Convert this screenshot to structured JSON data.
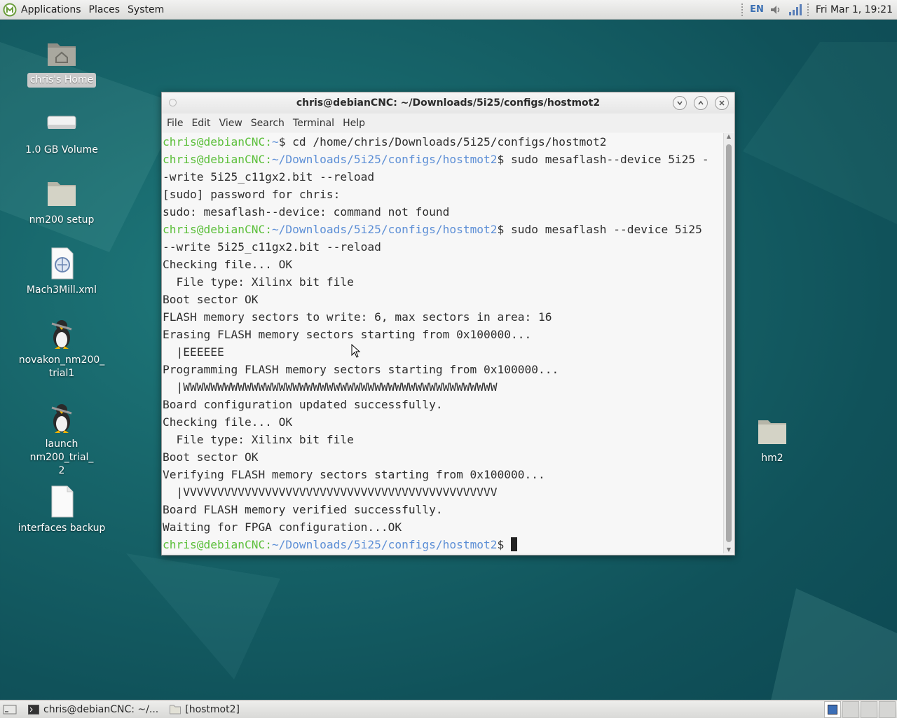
{
  "top_panel": {
    "menus": [
      "Applications",
      "Places",
      "System"
    ],
    "lang": "EN",
    "clock": "Fri Mar  1, 19:21"
  },
  "desktop": {
    "icons": [
      {
        "label": "chris's Home",
        "icon": "home-folder-icon"
      },
      {
        "label": "1.0 GB Volume",
        "icon": "drive-icon"
      },
      {
        "label": "nm200 setup",
        "icon": "folder-icon"
      },
      {
        "label": "Mach3Mill.xml",
        "icon": "xml-file-icon"
      },
      {
        "label": "novakon_nm200_\ntrial1",
        "icon": "linuxcnc-launcher-icon"
      },
      {
        "label": "launch nm200_trial_\n2",
        "icon": "linuxcnc-launcher-icon"
      },
      {
        "label": "interfaces backup",
        "icon": "text-file-icon"
      },
      {
        "label": "hm2",
        "icon": "folder-icon"
      }
    ]
  },
  "terminal": {
    "title": "chris@debianCNC: ~/Downloads/5i25/configs/hostmot2",
    "menu": [
      "File",
      "Edit",
      "View",
      "Search",
      "Terminal",
      "Help"
    ],
    "lines": [
      {
        "user": "chris@debianCNC",
        "path": "~",
        "text": "$ cd /home/chris/Downloads/5i25/configs/hostmot2"
      },
      {
        "user": "chris@debianCNC",
        "path": "~/Downloads/5i25/configs/hostmot2",
        "text": "$ sudo mesaflash--device 5i25 -"
      },
      {
        "text": "-write 5i25_c11gx2.bit --reload"
      },
      {
        "text": "[sudo] password for chris:"
      },
      {
        "text": "sudo: mesaflash--device: command not found"
      },
      {
        "user": "chris@debianCNC",
        "path": "~/Downloads/5i25/configs/hostmot2",
        "text": "$ sudo mesaflash --device 5i25"
      },
      {
        "text": "--write 5i25_c11gx2.bit --reload"
      },
      {
        "text": "Checking file... OK"
      },
      {
        "text": "  File type: Xilinx bit file"
      },
      {
        "text": "Boot sector OK"
      },
      {
        "text": "FLASH memory sectors to write: 6, max sectors in area: 16"
      },
      {
        "text": "Erasing FLASH memory sectors starting from 0x100000..."
      },
      {
        "text": "  |EEEEEE"
      },
      {
        "text": "Programming FLASH memory sectors starting from 0x100000..."
      },
      {
        "text": "  |WWWWWWWWWWWWWWWWWWWWWWWWWWWWWWWWWWWWWWWWWWWWWW"
      },
      {
        "text": "Board configuration updated successfully."
      },
      {
        "text": "Checking file... OK"
      },
      {
        "text": "  File type: Xilinx bit file"
      },
      {
        "text": "Boot sector OK"
      },
      {
        "text": "Verifying FLASH memory sectors starting from 0x100000..."
      },
      {
        "text": "  |VVVVVVVVVVVVVVVVVVVVVVVVVVVVVVVVVVVVVVVVVVVVVV"
      },
      {
        "text": "Board FLASH memory verified successfully."
      },
      {
        "text": "Waiting for FPGA configuration...OK"
      },
      {
        "user": "chris@debianCNC",
        "path": "~/Downloads/5i25/configs/hostmot2",
        "text": "$ ",
        "cursor": true
      }
    ]
  },
  "bottom_panel": {
    "tasks": [
      "chris@debianCNC: ~/...",
      "[hostmot2]"
    ]
  }
}
